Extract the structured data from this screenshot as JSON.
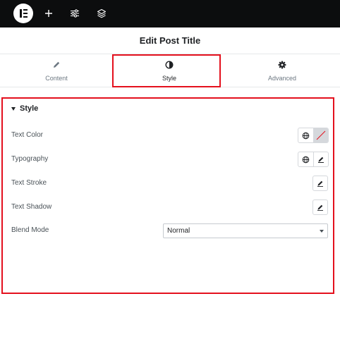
{
  "topbar": {
    "logo": "elementor-logo",
    "buttons": [
      {
        "icon": "plus-icon"
      },
      {
        "icon": "sliders-icon"
      },
      {
        "icon": "layers-icon"
      }
    ]
  },
  "header": {
    "title": "Edit Post Title"
  },
  "tabs": [
    {
      "label": "Content",
      "icon": "pencil-icon"
    },
    {
      "label": "Style",
      "icon": "contrast-icon",
      "active": true
    },
    {
      "label": "Advanced",
      "icon": "gear-icon"
    }
  ],
  "section": {
    "title": "Style",
    "controls": {
      "text_color": {
        "label": "Text Color"
      },
      "typography": {
        "label": "Typography"
      },
      "text_stroke": {
        "label": "Text Stroke"
      },
      "text_shadow": {
        "label": "Text Shadow"
      },
      "blend_mode": {
        "label": "Blend Mode",
        "value": "Normal"
      }
    }
  },
  "colors": {
    "topbar_bg": "#0c0d0e",
    "highlight": "#e4101d",
    "border": "#d5d8dc",
    "text_primary": "#1f2124",
    "text_muted": "#6d7882"
  }
}
